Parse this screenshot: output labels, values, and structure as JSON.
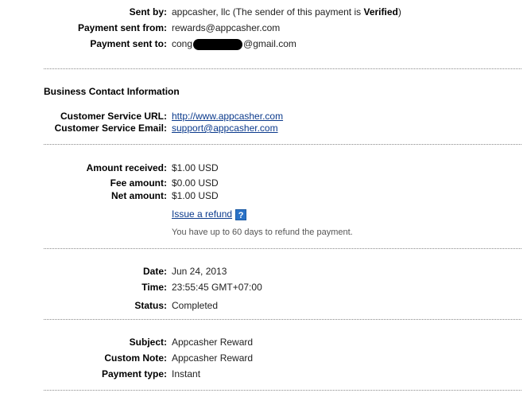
{
  "sender": {
    "sent_by_label": "Sent by:",
    "sent_by_name": "appcasher, llc",
    "verified_prefix": "(The sender of this payment is ",
    "verified_word": "Verified",
    "verified_suffix": ")",
    "sent_from_label": "Payment sent from:",
    "sent_from_value": "rewards@appcasher.com",
    "sent_to_label": "Payment sent to:",
    "sent_to_prefix": "cong",
    "sent_to_suffix": "@gmail.com"
  },
  "business": {
    "heading": "Business Contact Information",
    "url_label": "Customer Service URL:",
    "url_value": "http://www.appcasher.com",
    "email_label": "Customer Service Email:",
    "email_value": "support@appcasher.com"
  },
  "amounts": {
    "received_label": "Amount received:",
    "received_value": "$1.00 USD",
    "fee_label": "Fee amount:",
    "fee_value": "$0.00 USD",
    "net_label": "Net amount:",
    "net_value": "$1.00 USD",
    "refund_link": "Issue a refund",
    "refund_help": "?",
    "refund_note": "You have up to 60 days to refund the payment."
  },
  "details": {
    "date_label": "Date:",
    "date_value": "Jun 24, 2013",
    "time_label": "Time:",
    "time_value": "23:55:45 GMT+07:00",
    "status_label": "Status:",
    "status_value": "Completed"
  },
  "message": {
    "subject_label": "Subject:",
    "subject_value": "Appcasher Reward",
    "note_label": "Custom Note:",
    "note_value": "Appcasher Reward",
    "type_label": "Payment type:",
    "type_value": "Instant"
  }
}
